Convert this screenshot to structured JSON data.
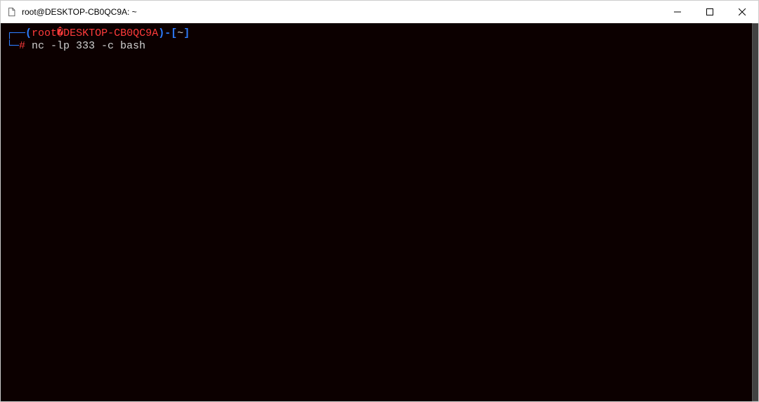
{
  "window": {
    "title": "root@DESKTOP-CB0QC9A: ~"
  },
  "prompt": {
    "corner_top": "┌──",
    "open_paren": "(",
    "user": "root",
    "diamond": "�",
    "host": "DESKTOP-CB0QC9A",
    "close_paren": ")",
    "dash": "-",
    "lbracket": "[",
    "cwd": "~",
    "rbracket": "]",
    "corner_bottom": "└─",
    "hash": "#",
    "command": " nc -lp 333 -c bash"
  }
}
